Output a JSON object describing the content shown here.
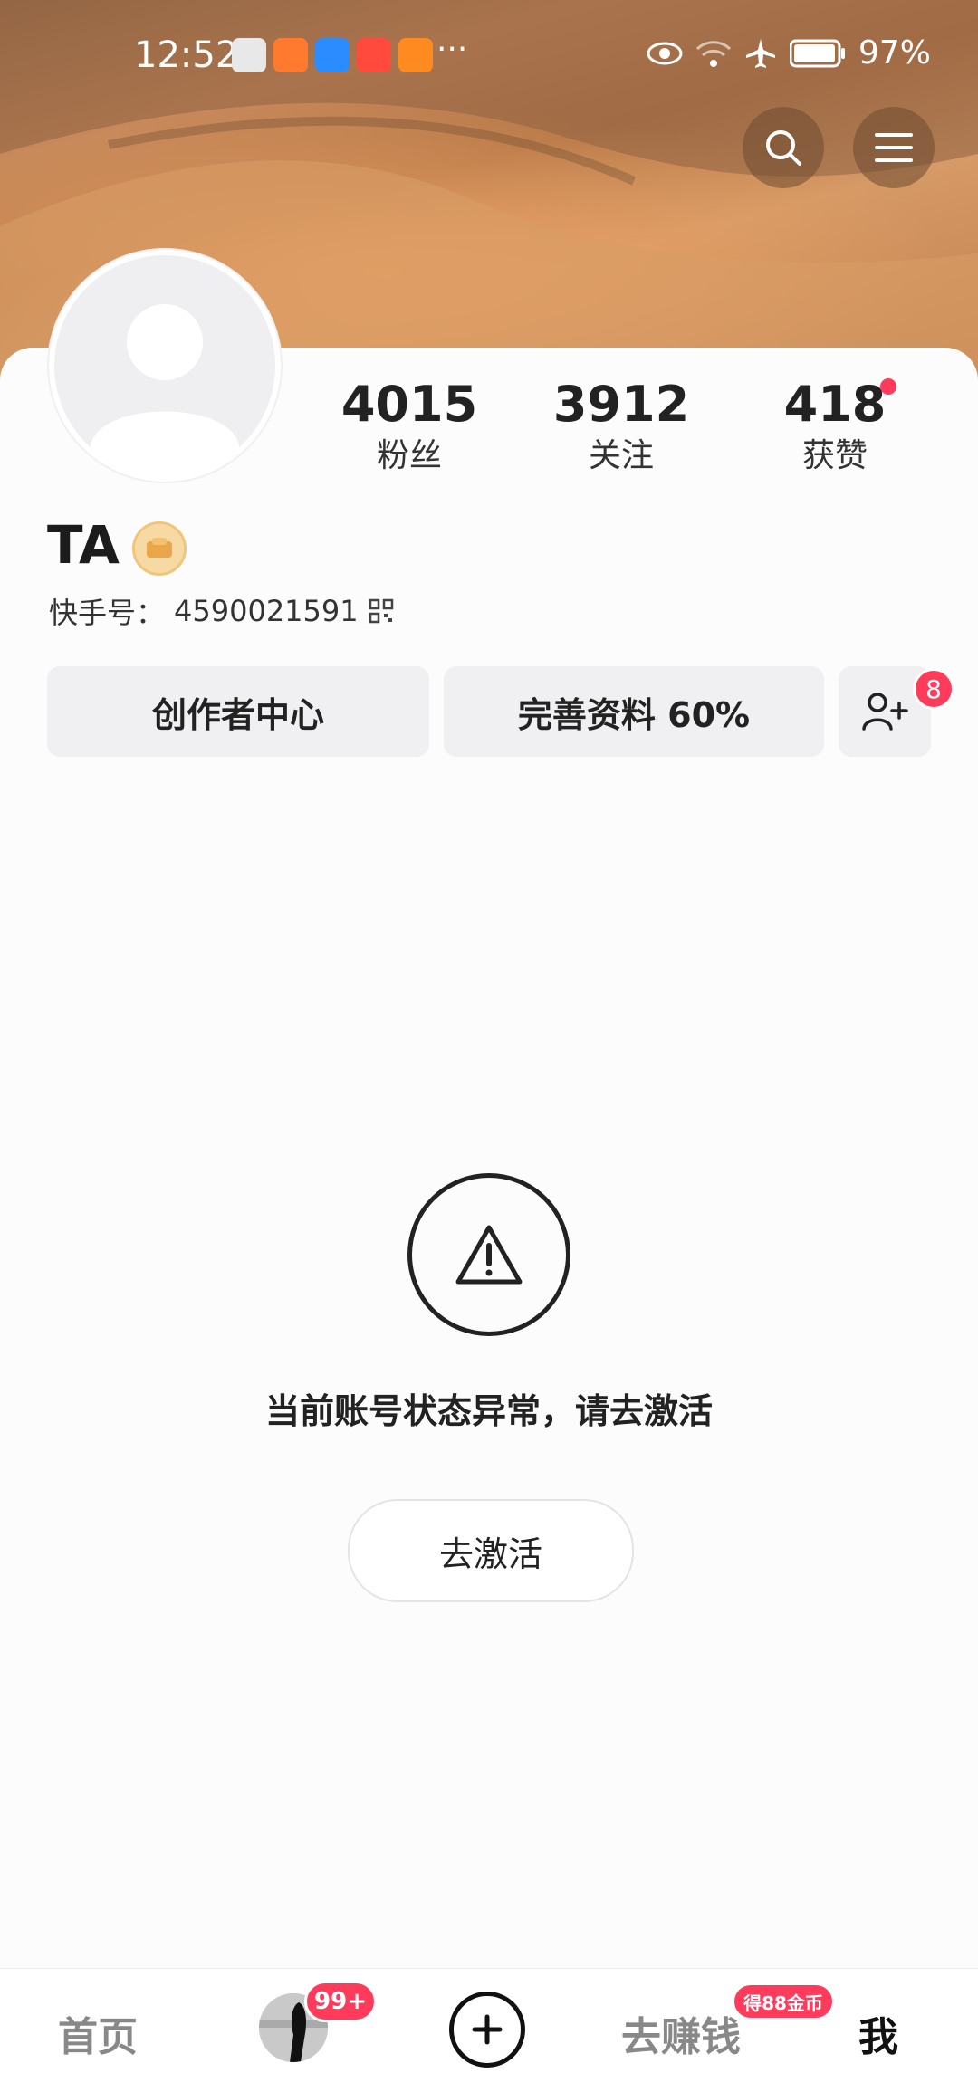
{
  "status_bar": {
    "time": "12:52",
    "more": "···",
    "battery": "97%"
  },
  "profile": {
    "name": "TA",
    "id_label": "快手号：",
    "id_value": "4590021591",
    "stats": [
      {
        "value": "4015",
        "label": "粉丝"
      },
      {
        "value": "3912",
        "label": "关注"
      },
      {
        "value": "418",
        "label": "获赞"
      }
    ]
  },
  "actions": {
    "creator_center": "创作者中心",
    "complete_profile": "完善资料 60%",
    "add_friend_badge": "8"
  },
  "notice": {
    "message": "当前账号状态异常，请去激活",
    "activate_button": "去激活"
  },
  "tabbar": {
    "home": "首页",
    "follow_badge": "99+",
    "earn": "去赚钱",
    "earn_badge": "得88金币",
    "me": "我"
  },
  "colors": {
    "accent": "#ff3b5c",
    "header_sand": "#c7895a"
  }
}
